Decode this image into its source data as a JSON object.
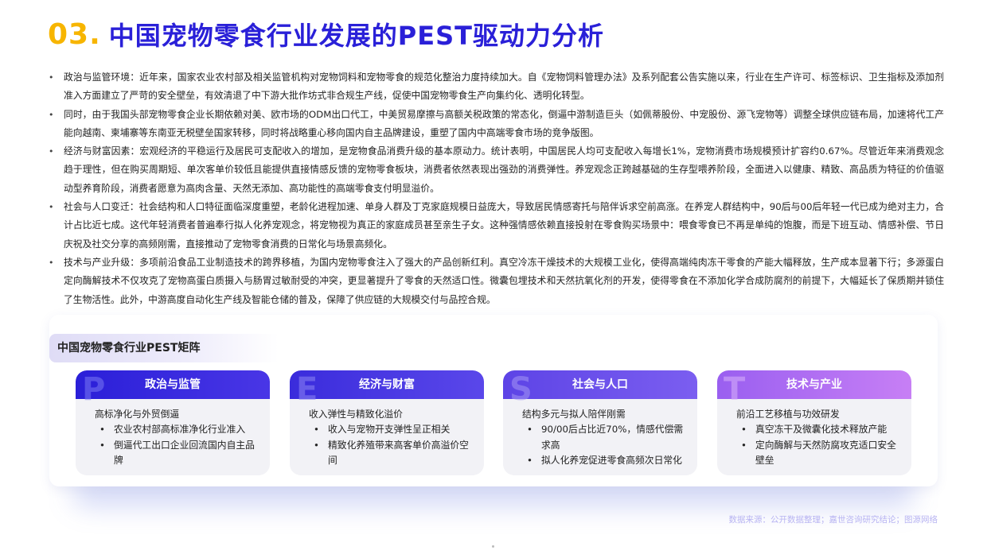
{
  "header": {
    "number": "03.",
    "title": "中国宠物零食行业发展的PEST驱动力分析"
  },
  "bullets": [
    "政治与监管环境：近年来，国家农业农村部及相关监管机构对宠物饲料和宠物零食的规范化整治力度持续加大。自《宠物饲料管理办法》及系列配套公告实施以来，行业在生产许可、标签标识、卫生指标及添加剂准入方面建立了严苛的安全壁垒，有效清退了中下游大批作坊式非合规生产线，促使中国宠物零食生产向集约化、透明化转型。",
    "同时，由于我国头部宠物零食企业长期依赖对美、欧市场的ODM出口代工，中美贸易摩擦与高额关税政策的常态化，倒逼中游制造巨头（如佩蒂股份、中宠股份、源飞宠物等）调整全球供应链布局，加速将代工产能向越南、柬埔寨等东南亚无税壁垒国家转移，同时将战略重心移向国内自主品牌建设，重塑了国内中高端零食市场的竞争版图。",
    "经济与财富因素：宏观经济的平稳运行及居民可支配收入的增加，是宠物食品消费升级的基本原动力。统计表明，中国居民人均可支配收入每增长1%，宠物消费市场规模预计扩容约0.67%。尽管近年来消费观念趋于理性，但在购买周期短、单次客单价较低且能提供直接情感反馈的宠物零食板块，消费者依然表现出强劲的消费弹性。养宠观念正跨越基础的生存型喂养阶段，全面进入以健康、精致、高品质为特征的价值驱动型养育阶段，消费者愿意为高肉含量、天然无添加、高功能性的高端零食支付明显溢价。",
    "社会与人口变迁：社会结构和人口特征面临深度重塑，老龄化进程加速、单身人群及丁克家庭规模日益庞大，导致居民情感寄托与陪伴诉求空前高涨。在养宠人群结构中，90后与00后年轻一代已成为绝对主力，合计占比近七成。这代年轻消费者普遍奉行拟人化养宠观念，将宠物视为真正的家庭成员甚至亲生子女。这种强情感依赖直接投射在零食购买场景中：喂食零食已不再是单纯的饱腹，而是下班互动、情感补偿、节日庆祝及社交分享的高频刚需，直接推动了宠物零食消费的日常化与场景高频化。",
    "技术与产业升级：多项前沿食品工业制造技术的跨界移植，为国内宠物零食注入了强大的产品创新红利。真空冷冻干燥技术的大规模工业化，使得高端纯肉冻干零食的产能大幅释放，生产成本显著下行；多源蛋白定向酶解技术不仅攻克了宠物高蛋白质摄入与肠胃过敏耐受的冲突，更显著提升了零食的天然适口性。微囊包埋技术和天然抗氧化剂的开发，使得零食在不添加化学合成防腐剂的前提下，大幅延长了保质期并锁住了生物活性。此外，中游高度自动化生产线及智能仓储的普及，保障了供应链的大规模交付与品控合规。"
  ],
  "matrix": {
    "tag": "中国宠物零食行业PEST矩阵",
    "cards": [
      {
        "letter": "P",
        "title": "政治与监管",
        "sub": "高标净化与外贸倒逼",
        "items": [
          "农业农村部高标准净化行业准入",
          "倒逼代工出口企业回流国内自主品牌"
        ]
      },
      {
        "letter": "E",
        "title": "经济与财富",
        "sub": "收入弹性与精致化溢价",
        "items": [
          "收入与宠物开支弹性呈正相关",
          "精致化养殖带来高客单价高溢价空间"
        ]
      },
      {
        "letter": "S",
        "title": "社会与人口",
        "sub": "结构多元与拟人陪伴刚需",
        "items": [
          "90/00后占比近70%，情感代偿需求高",
          "拟人化养宠促进零食高频次日常化"
        ]
      },
      {
        "letter": "T",
        "title": "技术与产业",
        "sub": "前沿工艺移植与功效研发",
        "items": [
          "真空冻干及微囊化技术释放产能",
          "定向酶解与天然防腐攻克适口安全壁垒"
        ]
      }
    ]
  },
  "footer": {
    "source": "数据来源：公开数据整理；嘉世咨询研究结论；图源网络"
  },
  "colors": {
    "accent_yellow": "#f7b500",
    "brand_blue": "#2a20d8",
    "card_purple": "#c77ff5"
  }
}
